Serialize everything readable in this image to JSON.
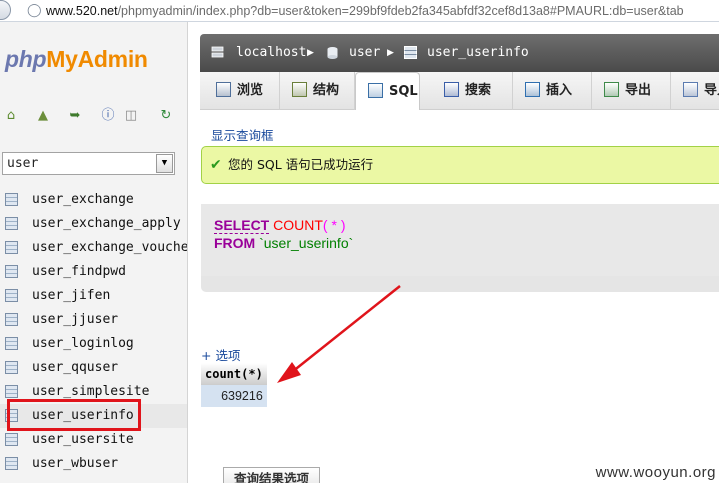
{
  "browser": {
    "url_host": "www.520.net",
    "url_rest": "/phpmyadmin/index.php?db=user&token=299bf9fdeb2fa345abfdf32cef8d13a8#PMAURL:db=user&tab"
  },
  "sidebar": {
    "logo_php": "php",
    "logo_my": "My",
    "logo_admin": "Admin",
    "db_select_value": "user",
    "tables": [
      "user_exchange",
      "user_exchange_apply",
      "user_exchange_vouche",
      "user_findpwd",
      "user_jifen",
      "user_jjuser",
      "user_loginlog",
      "user_qquser",
      "user_simplesite",
      "user_userinfo",
      "user_usersite",
      "user_wbuser"
    ],
    "active_table": "user_userinfo"
  },
  "breadcrumb": {
    "server": "localhost",
    "database": "user",
    "table": "user_userinfo"
  },
  "tabs": [
    {
      "label": "浏览",
      "icon": "browse-icon"
    },
    {
      "label": "结构",
      "icon": "structure-icon"
    },
    {
      "label": "SQL",
      "icon": "sql-icon"
    },
    {
      "label": "搜索",
      "icon": "search-icon"
    },
    {
      "label": "插入",
      "icon": "insert-icon"
    },
    {
      "label": "导出",
      "icon": "export-icon"
    },
    {
      "label": "导入",
      "icon": "import-icon"
    }
  ],
  "active_tab": "SQL",
  "main": {
    "show_query_link": "显示查询框",
    "success_message": "您的 SQL 语句已成功运行",
    "sql": {
      "select_kw": "SELECT",
      "count_fn": "COUNT",
      "open_paren": "(",
      "star": " * ",
      "close_paren": ")",
      "from_kw": "FROM",
      "table_name": "`user_userinfo`"
    },
    "options_link": "+ 选项",
    "result": {
      "column_header": "count(*)",
      "value": "639216"
    },
    "results_options_label": "查询结果选项"
  },
  "watermark": "www.wooyun.org",
  "colors": {
    "annotation_red": "#e0141b",
    "success_bg": "#ebf8a4",
    "sql_keyword": "#990099"
  }
}
